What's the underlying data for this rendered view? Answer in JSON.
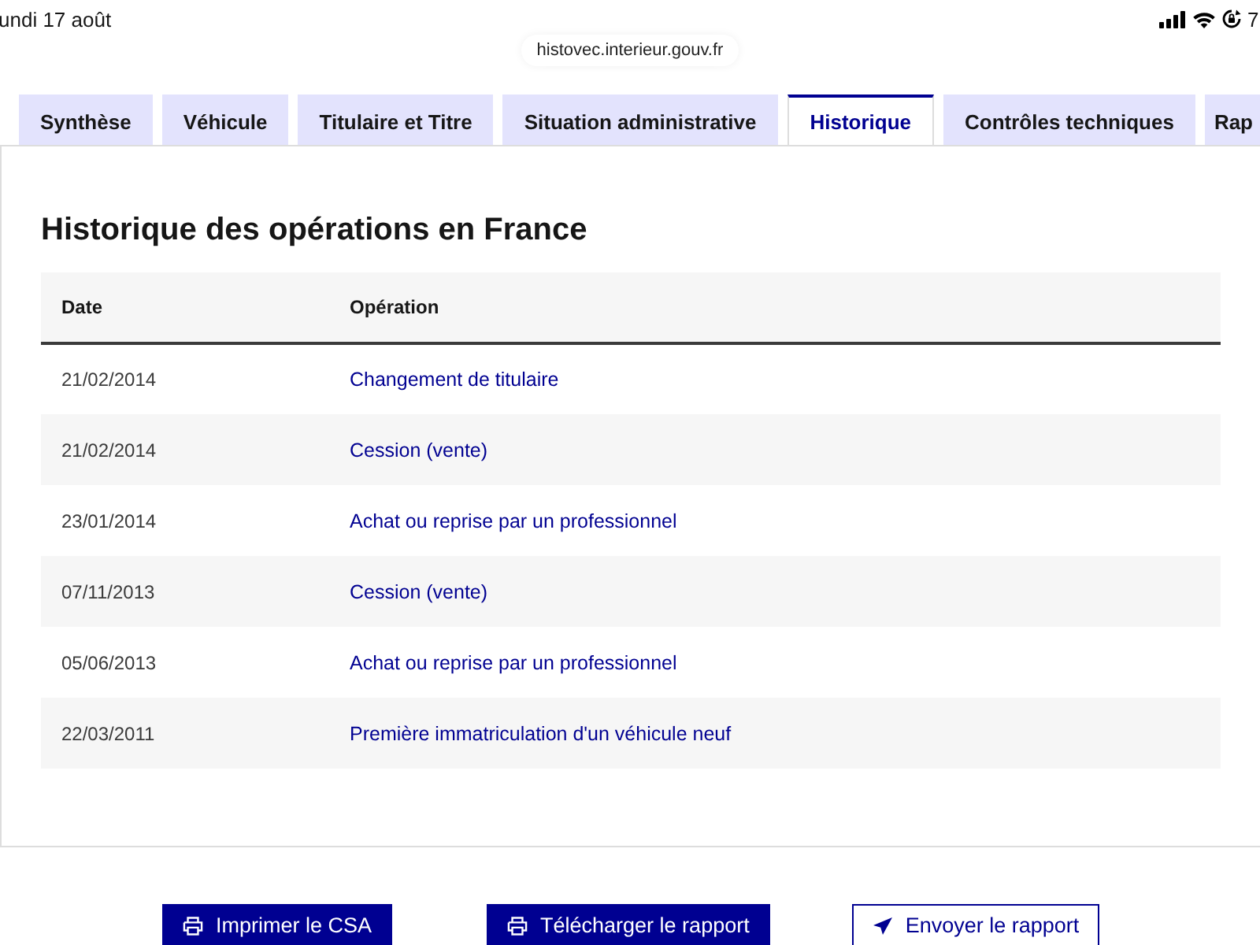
{
  "status_bar": {
    "date": "undi 17 août",
    "battery": "7"
  },
  "address_bar": {
    "url": "histovec.interieur.gouv.fr"
  },
  "tabs": [
    {
      "label": "Synthèse",
      "selected": false
    },
    {
      "label": "Véhicule",
      "selected": false
    },
    {
      "label": "Titulaire et Titre",
      "selected": false
    },
    {
      "label": "Situation administrative",
      "selected": false
    },
    {
      "label": "Historique",
      "selected": true
    },
    {
      "label": "Contrôles techniques",
      "selected": false
    },
    {
      "label": "Rap",
      "selected": false
    }
  ],
  "section": {
    "title": "Historique des opérations en France",
    "table": {
      "columns": [
        "Date",
        "Opération"
      ],
      "rows": [
        {
          "date": "21/02/2014",
          "operation": "Changement de titulaire"
        },
        {
          "date": "21/02/2014",
          "operation": "Cession (vente)"
        },
        {
          "date": "23/01/2014",
          "operation": "Achat ou reprise par un professionnel"
        },
        {
          "date": "07/11/2013",
          "operation": "Cession (vente)"
        },
        {
          "date": "05/06/2013",
          "operation": "Achat ou reprise par un professionnel"
        },
        {
          "date": "22/03/2011",
          "operation": "Première immatriculation d'un véhicule neuf"
        }
      ]
    }
  },
  "actions": [
    {
      "label": "Imprimer le CSA",
      "kind": "primary"
    },
    {
      "label": "Télécharger le rapport",
      "kind": "primary"
    },
    {
      "label": "Envoyer le rapport",
      "kind": "secondary"
    }
  ]
}
